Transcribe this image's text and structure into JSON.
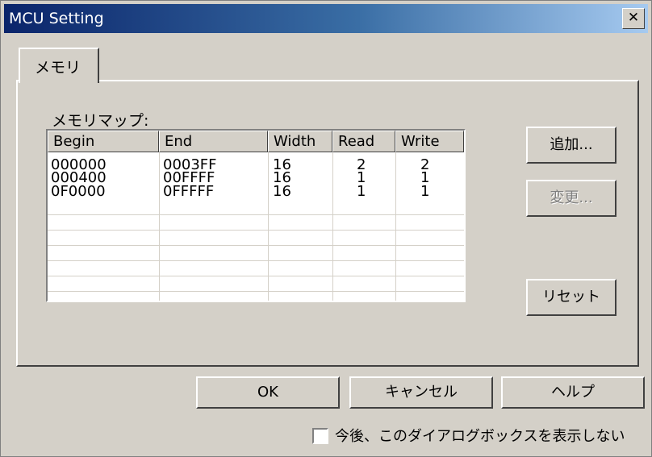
{
  "window": {
    "title": "MCU Setting",
    "close_label": "✕"
  },
  "tabs": [
    {
      "label": "メモリ"
    }
  ],
  "memory_map": {
    "label": "メモリマップ:",
    "columns": [
      "Begin",
      "End",
      "Width",
      "Read",
      "Write"
    ],
    "rows": [
      [
        "000000",
        "0003FF",
        "16",
        "2",
        "2"
      ],
      [
        "000400",
        "00FFFF",
        "16",
        "1",
        "1"
      ],
      [
        "0F0000",
        "0FFFFF",
        "16",
        "1",
        "1"
      ]
    ]
  },
  "side_buttons": {
    "add": "追加...",
    "change": "変更...",
    "reset": "リセット"
  },
  "footer": {
    "ok": "OK",
    "cancel": "キャンセル",
    "help": "ヘルプ",
    "dont_show_label": "今後、このダイアログボックスを表示しない",
    "dont_show_checked": false
  }
}
